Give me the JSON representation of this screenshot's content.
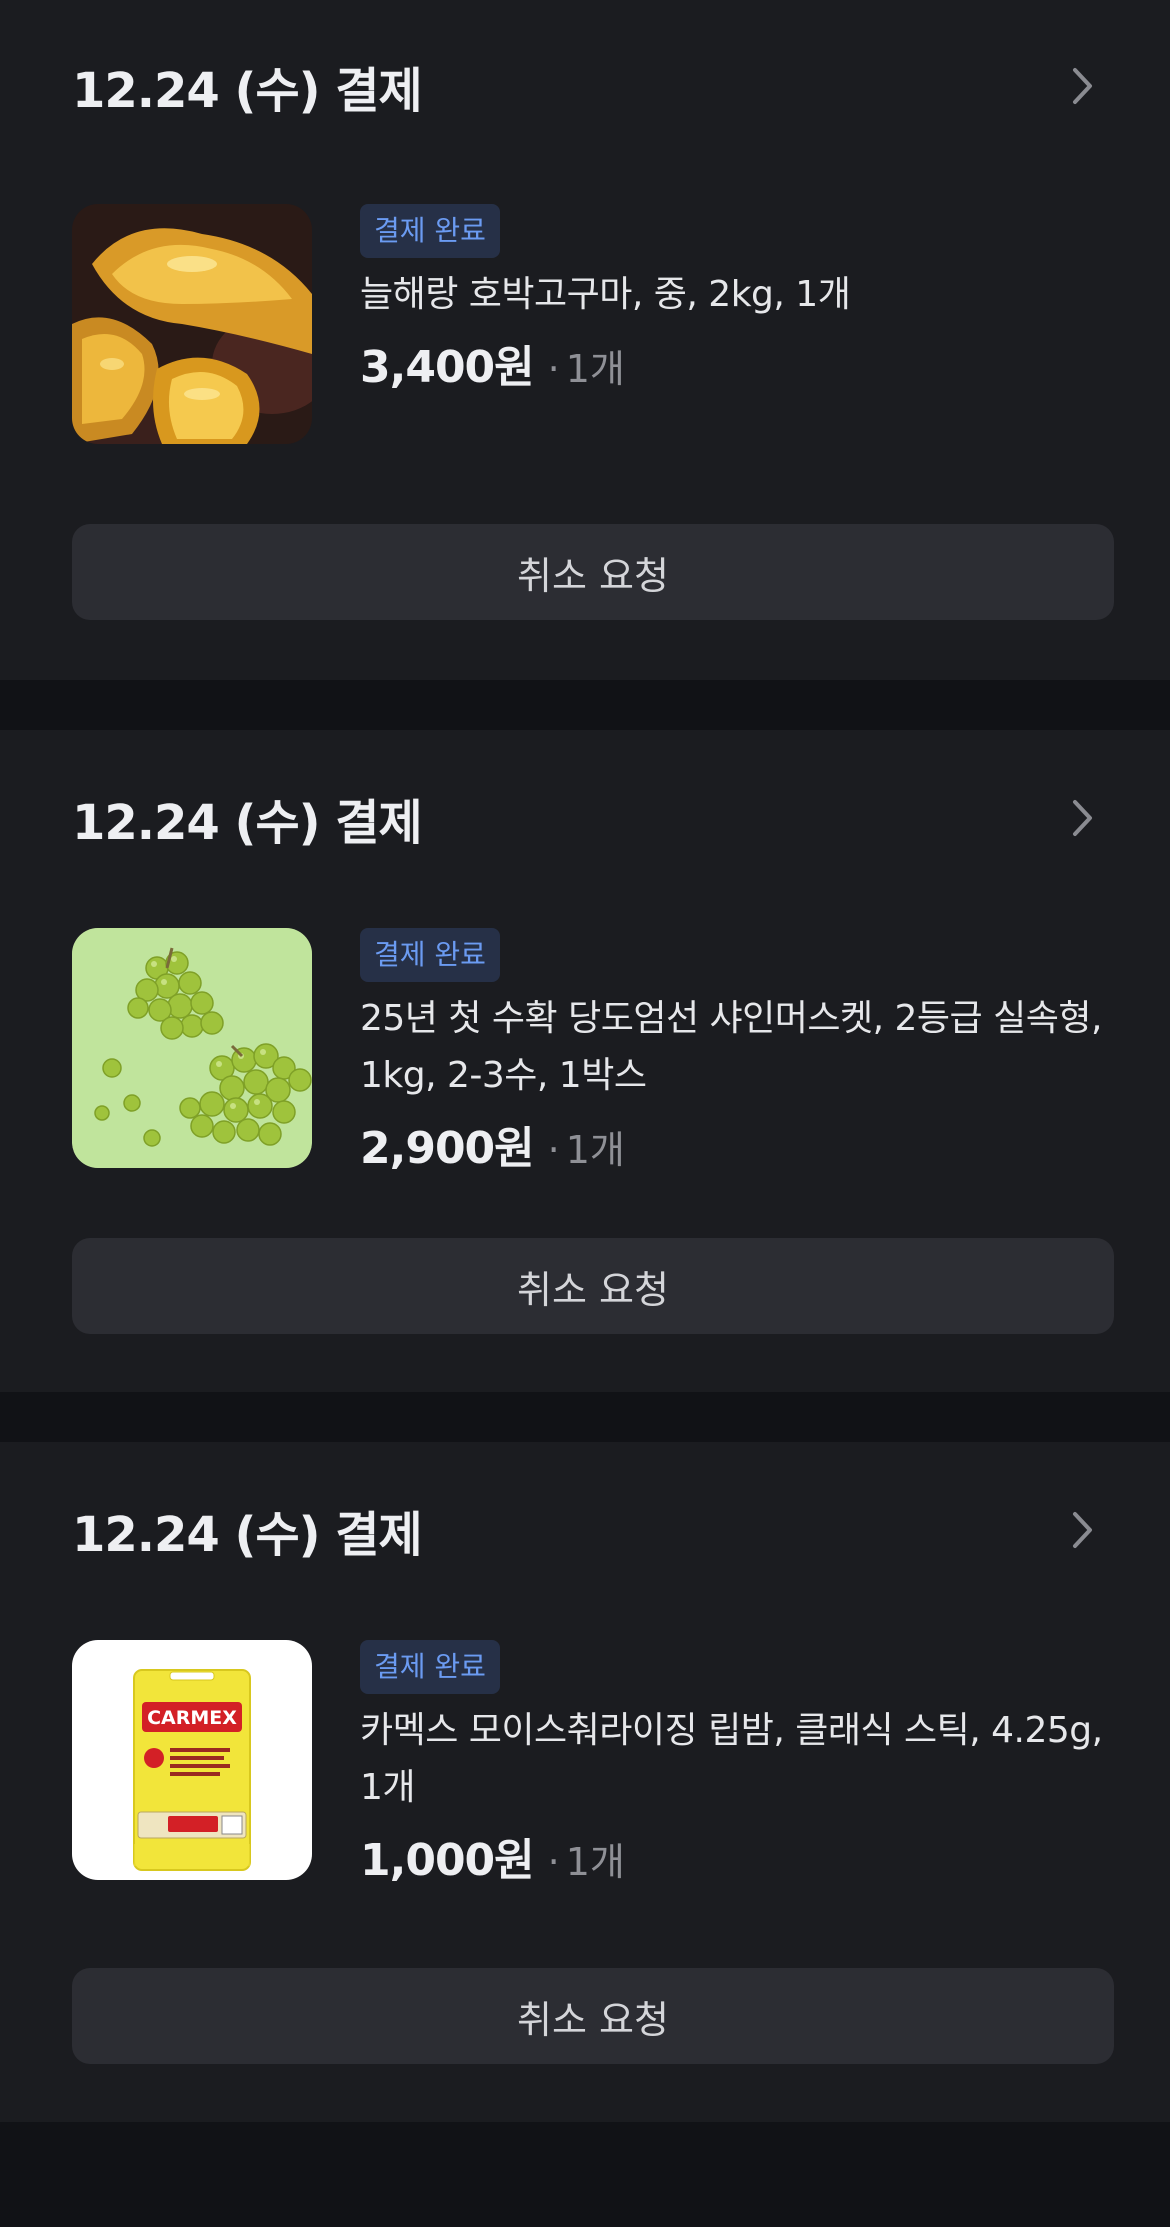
{
  "orders": [
    {
      "date_label": "12.24 (수) 결제",
      "status": "결제 완료",
      "product_name": "늘해랑 호박고구마, 중, 2kg, 1개",
      "price": "3,400원",
      "quantity": "1개",
      "image_icon": "sweet-potato-image",
      "cancel_label": "취소 요청"
    },
    {
      "date_label": "12.24 (수) 결제",
      "status": "결제 완료",
      "product_name": "25년 첫 수확 당도엄선 샤인머스켓, 2등급 실속형, 1kg, 2-3수, 1박스",
      "price": "2,900원",
      "quantity": "1개",
      "image_icon": "shine-muscat-image",
      "cancel_label": "취소 요청"
    },
    {
      "date_label": "12.24 (수) 결제",
      "status": "결제 완료",
      "product_name": "카멕스 모이스춰라이징 립밤, 클래식 스틱, 4.25g, 1개",
      "price": "1,000원",
      "quantity": "1개",
      "image_icon": "carmex-lip-balm-image",
      "image_text": "CARMEX",
      "cancel_label": "취소 요청"
    }
  ],
  "colors": {
    "background": "#111216",
    "card": "#1b1c20",
    "badge_bg": "#263047",
    "badge_text": "#6b9bf2",
    "button_bg": "#2c2d33"
  }
}
